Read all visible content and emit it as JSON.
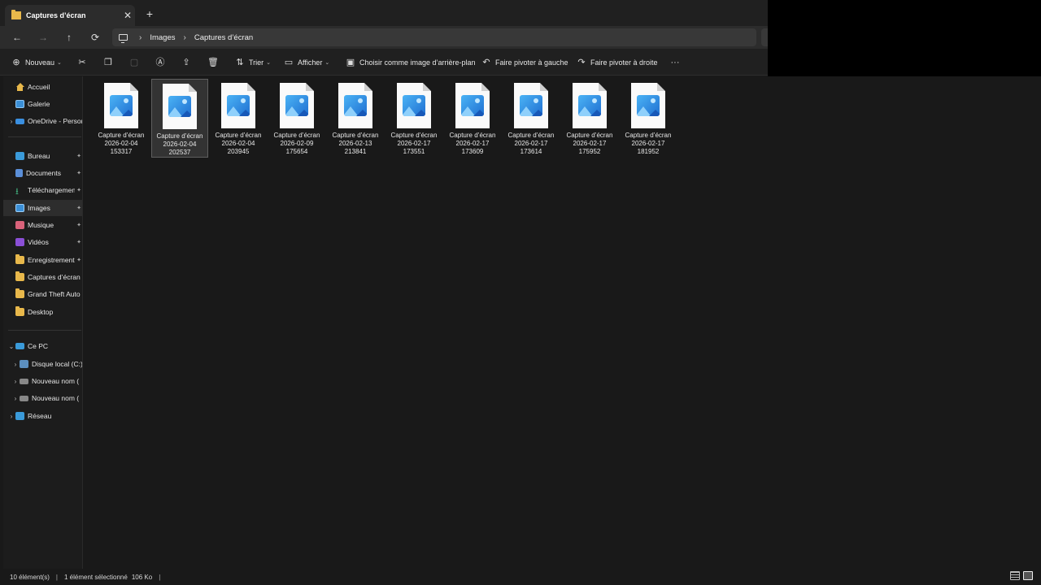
{
  "window": {
    "tab_title": "Captures d’écran",
    "tab_close": "✕",
    "new_tab": "+"
  },
  "navigation": {
    "back": "←",
    "forward": "→",
    "up": "↑",
    "refresh": "⟳",
    "breadcrumb": [
      "Images",
      "Captures d’écran"
    ],
    "separator": "›"
  },
  "toolbar": {
    "new_label": "Nouveau",
    "sort_label": "Trier",
    "view_label": "Afficher",
    "set_background_label": "Choisir comme image d’arrière-plan",
    "rotate_left_label": "Faire pivoter à gauche",
    "rotate_right_label": "Faire pivoter à droite",
    "more": "···"
  },
  "sidebar": {
    "items": [
      {
        "label": "Accueil",
        "icon": "home-icon"
      },
      {
        "label": "Galerie",
        "icon": "gallery-icon"
      },
      {
        "label": "OneDrive - Personnel",
        "icon": "onedrive-icon"
      },
      {
        "label": "Bureau",
        "icon": "desktop-icon"
      },
      {
        "label": "Documents",
        "icon": "documents-icon"
      },
      {
        "label": "Téléchargements",
        "icon": "download-icon"
      },
      {
        "label": "Images",
        "icon": "images-icon"
      },
      {
        "label": "Musique",
        "icon": "music-icon"
      },
      {
        "label": "Vidéos",
        "icon": "videos-icon"
      },
      {
        "label": "Enregistrements",
        "icon": "folder-icon"
      },
      {
        "label": "Captures d’écran",
        "icon": "folder-icon"
      },
      {
        "label": "Grand Theft Auto",
        "icon": "folder-icon"
      },
      {
        "label": "Desktop",
        "icon": "folder-icon"
      },
      {
        "label": "Ce PC",
        "icon": "pc-icon"
      },
      {
        "label": "Disque local (C:)",
        "icon": "disk-icon"
      },
      {
        "label": "Nouveau nom (",
        "icon": "disk-icon"
      },
      {
        "label": "Nouveau nom (",
        "icon": "disk-icon"
      },
      {
        "label": "Réseau",
        "icon": "network-icon"
      }
    ],
    "pin": "📌"
  },
  "files": [
    {
      "line1": "Capture d’écran",
      "line2": "2026-02-04",
      "line3": "153317",
      "selected": false
    },
    {
      "line1": "Capture d’écran",
      "line2": "2026-02-04",
      "line3": "202537",
      "selected": true
    },
    {
      "line1": "Capture d’écran",
      "line2": "2026-02-04",
      "line3": "203945",
      "selected": false
    },
    {
      "line1": "Capture d’écran",
      "line2": "2026-02-09",
      "line3": "175654",
      "selected": false
    },
    {
      "line1": "Capture d’écran",
      "line2": "2026-02-13",
      "line3": "213841",
      "selected": false
    },
    {
      "line1": "Capture d’écran",
      "line2": "2026-02-17",
      "line3": "173551",
      "selected": false
    },
    {
      "line1": "Capture d’écran",
      "line2": "2026-02-17",
      "line3": "173609",
      "selected": false
    },
    {
      "line1": "Capture d’écran",
      "line2": "2026-02-17",
      "line3": "173614",
      "selected": false
    },
    {
      "line1": "Capture d’écran",
      "line2": "2026-02-17",
      "line3": "175952",
      "selected": false
    },
    {
      "line1": "Capture d’écran",
      "line2": "2026-02-17",
      "line3": "181952",
      "selected": false
    }
  ],
  "status": {
    "count": "10 élément(s)",
    "selection": "1 élément sélectionné",
    "size": "106 Ko",
    "separator": "|"
  },
  "colors": {
    "accent": "#3b8fd6",
    "folder": "#e8b84b",
    "background": "#191919"
  }
}
